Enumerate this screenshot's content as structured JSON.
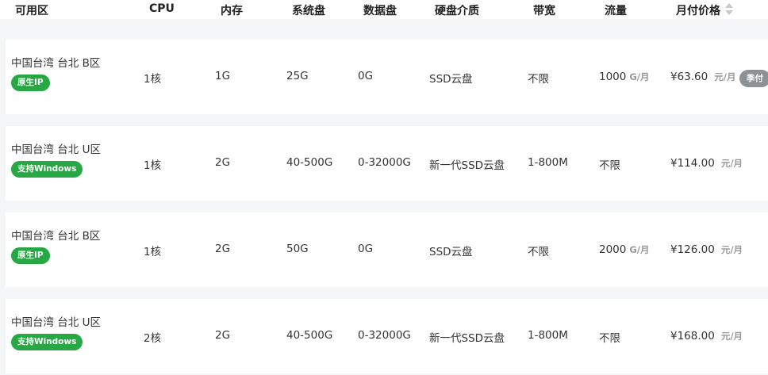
{
  "header": {
    "zone": "可用区",
    "cpu": "CPU",
    "memory": "内存",
    "system_disk": "系统盘",
    "data_disk": "数据盘",
    "disk_media": "硬盘介质",
    "bandwidth": "带宽",
    "traffic": "流量",
    "price": "月付价格"
  },
  "rows": [
    {
      "zone": "中国台湾 台北 B区",
      "tag": "原生IP",
      "cpu": "1核",
      "memory": "1G",
      "system_disk": "25G",
      "data_disk": "0G",
      "disk_media": "SSD云盘",
      "bandwidth": "不限",
      "traffic": "1000",
      "traffic_unit": "G/月",
      "price": "¥63.60",
      "price_unit": "元/月",
      "badge": "季付"
    },
    {
      "zone": "中国台湾 台北 U区",
      "tag": "支持Windows",
      "cpu": "1核",
      "memory": "2G",
      "system_disk": "40-500G",
      "data_disk": "0-32000G",
      "disk_media": "新一代SSD云盘",
      "bandwidth": "1-800M",
      "traffic": "不限",
      "traffic_unit": "",
      "price": "¥114.00",
      "price_unit": "元/月"
    },
    {
      "zone": "中国台湾 台北 B区",
      "tag": "原生IP",
      "cpu": "1核",
      "memory": "2G",
      "system_disk": "50G",
      "data_disk": "0G",
      "disk_media": "SSD云盘",
      "bandwidth": "不限",
      "traffic": "2000",
      "traffic_unit": "G/月",
      "price": "¥126.00",
      "price_unit": "元/月"
    },
    {
      "zone": "中国台湾 台北 U区",
      "tag": "支持Windows",
      "cpu": "2核",
      "memory": "2G",
      "system_disk": "40-500G",
      "data_disk": "0-32000G",
      "disk_media": "新一代SSD云盘",
      "bandwidth": "1-800M",
      "traffic": "不限",
      "traffic_unit": "",
      "price": "¥168.00",
      "price_unit": "元/月"
    }
  ],
  "colors": {
    "tag_green": "#27a844",
    "badge_gray": "#8c9196",
    "page_bg": "#f5f6f7"
  },
  "icons": {
    "sort": "sort-icon"
  }
}
